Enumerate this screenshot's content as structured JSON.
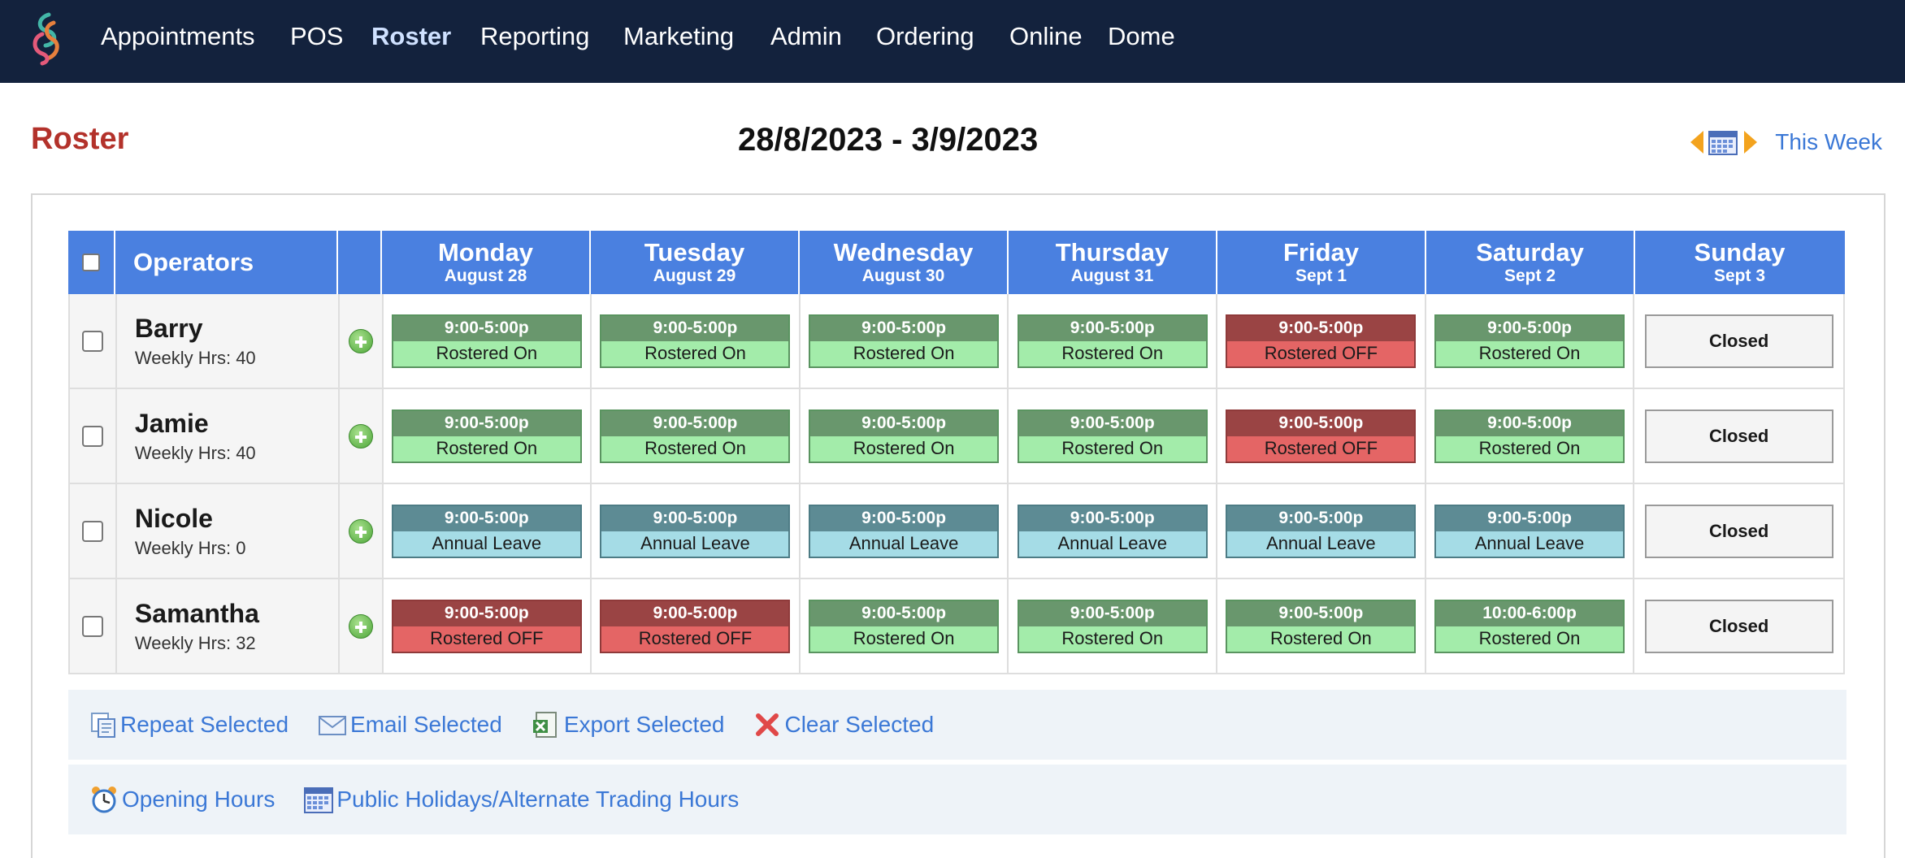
{
  "nav": {
    "items": [
      "Appointments",
      "POS",
      "Roster",
      "Reporting",
      "Marketing",
      "Admin",
      "Ordering",
      "Online",
      "Dome"
    ],
    "active": "Roster"
  },
  "header": {
    "title": "Roster",
    "date_range": "28/8/2023 - 3/9/2023",
    "this_week": "This Week"
  },
  "table": {
    "operators_label": "Operators",
    "days": [
      {
        "name": "Monday",
        "date": "August 28"
      },
      {
        "name": "Tuesday",
        "date": "August 29"
      },
      {
        "name": "Wednesday",
        "date": "August 30"
      },
      {
        "name": "Thursday",
        "date": "August 31"
      },
      {
        "name": "Friday",
        "date": "Sept 1"
      },
      {
        "name": "Saturday",
        "date": "Sept 2"
      },
      {
        "name": "Sunday",
        "date": "Sept 3"
      }
    ],
    "rows": [
      {
        "name": "Barry",
        "hours": "Weekly Hrs: 40",
        "shifts": [
          {
            "time": "9:00-5:00p",
            "status": "Rostered On",
            "kind": "on"
          },
          {
            "time": "9:00-5:00p",
            "status": "Rostered On",
            "kind": "on"
          },
          {
            "time": "9:00-5:00p",
            "status": "Rostered On",
            "kind": "on"
          },
          {
            "time": "9:00-5:00p",
            "status": "Rostered On",
            "kind": "on"
          },
          {
            "time": "9:00-5:00p",
            "status": "Rostered OFF",
            "kind": "off"
          },
          {
            "time": "9:00-5:00p",
            "status": "Rostered On",
            "kind": "on"
          }
        ],
        "sunday": "Closed"
      },
      {
        "name": "Jamie",
        "hours": "Weekly Hrs: 40",
        "shifts": [
          {
            "time": "9:00-5:00p",
            "status": "Rostered On",
            "kind": "on"
          },
          {
            "time": "9:00-5:00p",
            "status": "Rostered On",
            "kind": "on"
          },
          {
            "time": "9:00-5:00p",
            "status": "Rostered On",
            "kind": "on"
          },
          {
            "time": "9:00-5:00p",
            "status": "Rostered On",
            "kind": "on"
          },
          {
            "time": "9:00-5:00p",
            "status": "Rostered OFF",
            "kind": "off"
          },
          {
            "time": "9:00-5:00p",
            "status": "Rostered On",
            "kind": "on"
          }
        ],
        "sunday": "Closed"
      },
      {
        "name": "Nicole",
        "hours": "Weekly Hrs: 0",
        "shifts": [
          {
            "time": "9:00-5:00p",
            "status": "Annual Leave",
            "kind": "leave"
          },
          {
            "time": "9:00-5:00p",
            "status": "Annual Leave",
            "kind": "leave"
          },
          {
            "time": "9:00-5:00p",
            "status": "Annual Leave",
            "kind": "leave"
          },
          {
            "time": "9:00-5:00p",
            "status": "Annual Leave",
            "kind": "leave"
          },
          {
            "time": "9:00-5:00p",
            "status": "Annual Leave",
            "kind": "leave"
          },
          {
            "time": "9:00-5:00p",
            "status": "Annual Leave",
            "kind": "leave"
          }
        ],
        "sunday": "Closed"
      },
      {
        "name": "Samantha",
        "hours": "Weekly Hrs: 32",
        "shifts": [
          {
            "time": "9:00-5:00p",
            "status": "Rostered OFF",
            "kind": "off"
          },
          {
            "time": "9:00-5:00p",
            "status": "Rostered OFF",
            "kind": "off"
          },
          {
            "time": "9:00-5:00p",
            "status": "Rostered On",
            "kind": "on"
          },
          {
            "time": "9:00-5:00p",
            "status": "Rostered On",
            "kind": "on"
          },
          {
            "time": "9:00-5:00p",
            "status": "Rostered On",
            "kind": "on"
          },
          {
            "time": "10:00-6:00p",
            "status": "Rostered On",
            "kind": "on"
          }
        ],
        "sunday": "Closed"
      }
    ]
  },
  "actions": {
    "repeat": "Repeat Selected",
    "email": "Email Selected",
    "export": "Export Selected",
    "clear": "Clear Selected",
    "opening_hours": "Opening Hours",
    "holidays": "Public Holidays/Alternate Trading Hours"
  },
  "colors": {
    "nav_bg": "#13223d",
    "header_blue": "#4a80e0",
    "title_red": "#b3322b",
    "link_blue": "#3b78d6",
    "on_dark": "#69976d",
    "on_light": "#a3ecaa",
    "off_dark": "#9a4444",
    "off_light": "#e46565",
    "leave_dark": "#5d8b94",
    "leave_light": "#a5dce6"
  }
}
